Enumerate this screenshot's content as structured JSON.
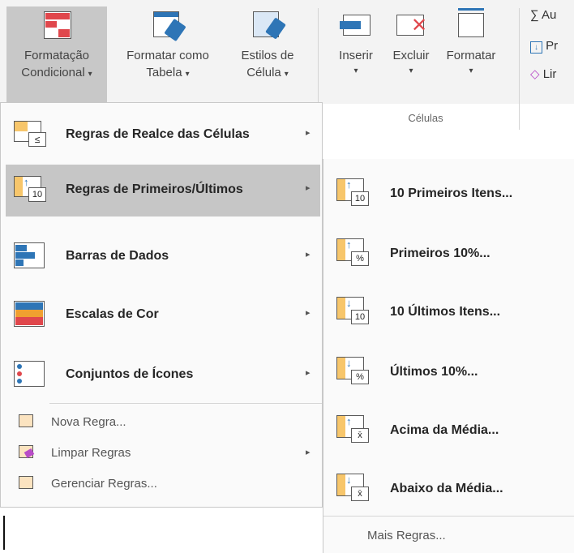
{
  "ribbon": {
    "buttons": [
      {
        "line1": "Formatação",
        "line2": "Condicional",
        "icon": "conditional-format-icon"
      },
      {
        "line1": "Formatar como",
        "line2": "Tabela",
        "icon": "format-as-table-icon"
      },
      {
        "line1": "Estilos de",
        "line2": "Célula",
        "icon": "cell-styles-icon"
      },
      {
        "line1": "Inserir",
        "icon": "insert-cells-icon"
      },
      {
        "line1": "Excluir",
        "icon": "delete-cells-icon"
      },
      {
        "line1": "Formatar",
        "icon": "format-cells-icon"
      }
    ],
    "group_label": "Células",
    "editing": [
      {
        "text": "∑ Au",
        "icon": "autosum-icon"
      },
      {
        "text": "Pr",
        "icon": "fill-icon"
      },
      {
        "text": "Lir",
        "icon": "eraser-icon"
      }
    ]
  },
  "main_menu": {
    "items": [
      {
        "label": "Regras de Realce das Células",
        "icon": "highlight-cells-rules-icon"
      },
      {
        "label": "Regras de Primeiros/Últimos",
        "icon": "top-bottom-rules-icon"
      },
      {
        "label": "Barras de Dados",
        "icon": "data-bars-icon"
      },
      {
        "label": "Escalas de Cor",
        "icon": "color-scales-icon"
      },
      {
        "label": "Conjuntos de Ícones",
        "icon": "icon-sets-icon"
      }
    ],
    "small_items": [
      {
        "label": "Nova Regra...",
        "icon": "new-rule-icon"
      },
      {
        "label": "Limpar Regras",
        "icon": "clear-rules-icon"
      },
      {
        "label": "Gerenciar Regras...",
        "icon": "manage-rules-icon"
      }
    ]
  },
  "sub_menu": {
    "items": [
      {
        "label": "10 Primeiros Itens...",
        "badge": "10",
        "icon": "top-10-items-icon"
      },
      {
        "label": "Primeiros 10%...",
        "badge": "%",
        "icon": "top-10-percent-icon"
      },
      {
        "label": "10 Últimos Itens...",
        "badge": "10",
        "icon": "bottom-10-items-icon"
      },
      {
        "label": "Últimos 10%...",
        "badge": "%",
        "icon": "bottom-10-percent-icon"
      },
      {
        "label": "Acima da Média...",
        "badge": "x̄",
        "icon": "above-average-icon"
      },
      {
        "label": "Abaixo da Média...",
        "badge": "x̄",
        "icon": "below-average-icon"
      }
    ],
    "more": "Mais Regras..."
  },
  "colors": {
    "hover": "#c6c6c6",
    "ribbon_bg": "#f3f3f3",
    "accent_blue": "#2e75b6",
    "accent_red": "#e0474c",
    "accent_orange": "#f0a030"
  }
}
